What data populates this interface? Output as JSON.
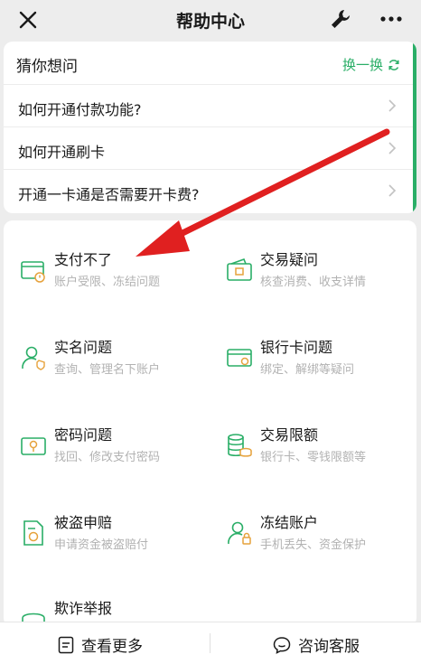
{
  "header": {
    "title": "帮助中心",
    "close_icon": "close-icon",
    "tool_icon": "wrench-icon",
    "more_icon": "more-icon"
  },
  "guess": {
    "title": "猜你想问",
    "refresh_label": "换一换",
    "questions": [
      "如何开通付款功能?",
      "如何开通刷卡",
      "开通一卡通是否需要开卡费?"
    ]
  },
  "categories": [
    {
      "title": "支付不了",
      "subtitle": "账户受限、冻结问题",
      "icon": "card-alert-icon"
    },
    {
      "title": "交易疑问",
      "subtitle": "核查消费、收支详情",
      "icon": "wallet-icon"
    },
    {
      "title": "实名问题",
      "subtitle": "查询、管理名下账户",
      "icon": "user-verify-icon"
    },
    {
      "title": "银行卡问题",
      "subtitle": "绑定、解绑等疑问",
      "icon": "bank-card-icon"
    },
    {
      "title": "密码问题",
      "subtitle": "找回、修改支付密码",
      "icon": "password-icon"
    },
    {
      "title": "交易限额",
      "subtitle": "银行卡、零钱限额等",
      "icon": "coins-icon"
    },
    {
      "title": "被盗申赔",
      "subtitle": "申请资金被盗赔付",
      "icon": "claim-doc-icon"
    },
    {
      "title": "冻结账户",
      "subtitle": "手机丢失、资金保护",
      "icon": "user-lock-icon"
    },
    {
      "title": "欺诈举报",
      "subtitle": "",
      "icon": "report-icon"
    }
  ],
  "bottom": {
    "more_label": "查看更多",
    "service_label": "咨询客服"
  },
  "colors": {
    "accent": "#2aae67",
    "annotation_arrow": "#e02020"
  }
}
